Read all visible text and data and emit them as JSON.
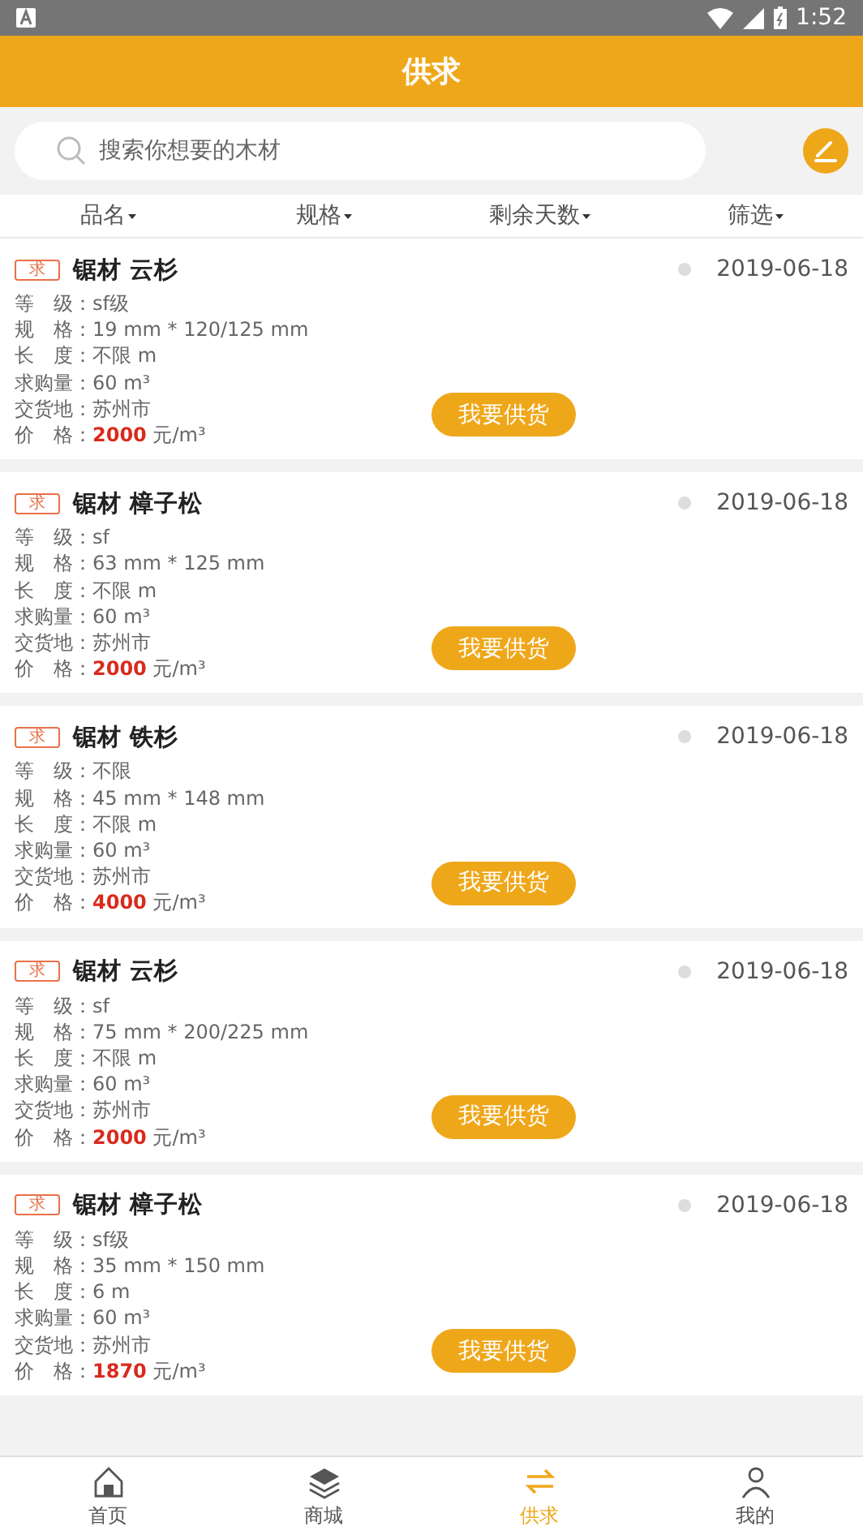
{
  "status_bar": {
    "time": "1:52"
  },
  "header": {
    "title": "供求"
  },
  "search": {
    "placeholder": "搜索你想要的木材"
  },
  "filters": [
    {
      "label": "品名"
    },
    {
      "label": "规格"
    },
    {
      "label": "剩余天数"
    },
    {
      "label": "筛选"
    }
  ],
  "separator": "：",
  "listings": [
    {
      "tag": "求",
      "title": "锯材 云杉",
      "date": "2019-06-18",
      "fields": [
        {
          "label": "等 级",
          "value": "sf级"
        },
        {
          "label": "规 格",
          "value": "19 mm * 120/125 mm"
        },
        {
          "label": "长 度",
          "value": "不限 m"
        },
        {
          "label": "求购量",
          "value": "60 m³"
        },
        {
          "label": "交货地",
          "value": "苏州市"
        }
      ],
      "price": {
        "label": "价 格",
        "amount": "2000",
        "unit": "元/m³"
      },
      "button": "我要供货"
    },
    {
      "tag": "求",
      "title": "锯材 樟子松",
      "date": "2019-06-18",
      "fields": [
        {
          "label": "等 级",
          "value": "sf"
        },
        {
          "label": "规 格",
          "value": "63 mm * 125 mm"
        },
        {
          "label": "长 度",
          "value": "不限 m"
        },
        {
          "label": "求购量",
          "value": "60 m³"
        },
        {
          "label": "交货地",
          "value": "苏州市"
        }
      ],
      "price": {
        "label": "价 格",
        "amount": "2000",
        "unit": "元/m³"
      },
      "button": "我要供货"
    },
    {
      "tag": "求",
      "title": "锯材 铁杉",
      "date": "2019-06-18",
      "fields": [
        {
          "label": "等 级",
          "value": "不限"
        },
        {
          "label": "规 格",
          "value": "45 mm * 148 mm"
        },
        {
          "label": "长 度",
          "value": "不限 m"
        },
        {
          "label": "求购量",
          "value": "60 m³"
        },
        {
          "label": "交货地",
          "value": "苏州市"
        }
      ],
      "price": {
        "label": "价 格",
        "amount": "4000",
        "unit": "元/m³"
      },
      "button": "我要供货"
    },
    {
      "tag": "求",
      "title": "锯材 云杉",
      "date": "2019-06-18",
      "fields": [
        {
          "label": "等 级",
          "value": "sf"
        },
        {
          "label": "规 格",
          "value": "75 mm * 200/225 mm"
        },
        {
          "label": "长 度",
          "value": "不限 m"
        },
        {
          "label": "求购量",
          "value": "60 m³"
        },
        {
          "label": "交货地",
          "value": "苏州市"
        }
      ],
      "price": {
        "label": "价 格",
        "amount": "2000",
        "unit": "元/m³"
      },
      "button": "我要供货"
    },
    {
      "tag": "求",
      "title": "锯材 樟子松",
      "date": "2019-06-18",
      "fields": [
        {
          "label": "等 级",
          "value": "sf级"
        },
        {
          "label": "规 格",
          "value": "35 mm * 150 mm"
        },
        {
          "label": "长 度",
          "value": "6 m"
        },
        {
          "label": "求购量",
          "value": "60 m³"
        },
        {
          "label": "交货地",
          "value": "苏州市"
        }
      ],
      "price": {
        "label": "价 格",
        "amount": "1870",
        "unit": "元/m³"
      },
      "button": "我要供货"
    }
  ],
  "tab_bar": [
    {
      "label": "首页",
      "kind": "home",
      "selected": false
    },
    {
      "label": "商城",
      "kind": "layers",
      "selected": false
    },
    {
      "label": "供求",
      "kind": "exchange",
      "selected": true
    },
    {
      "label": "我的",
      "kind": "person",
      "selected": false
    }
  ]
}
